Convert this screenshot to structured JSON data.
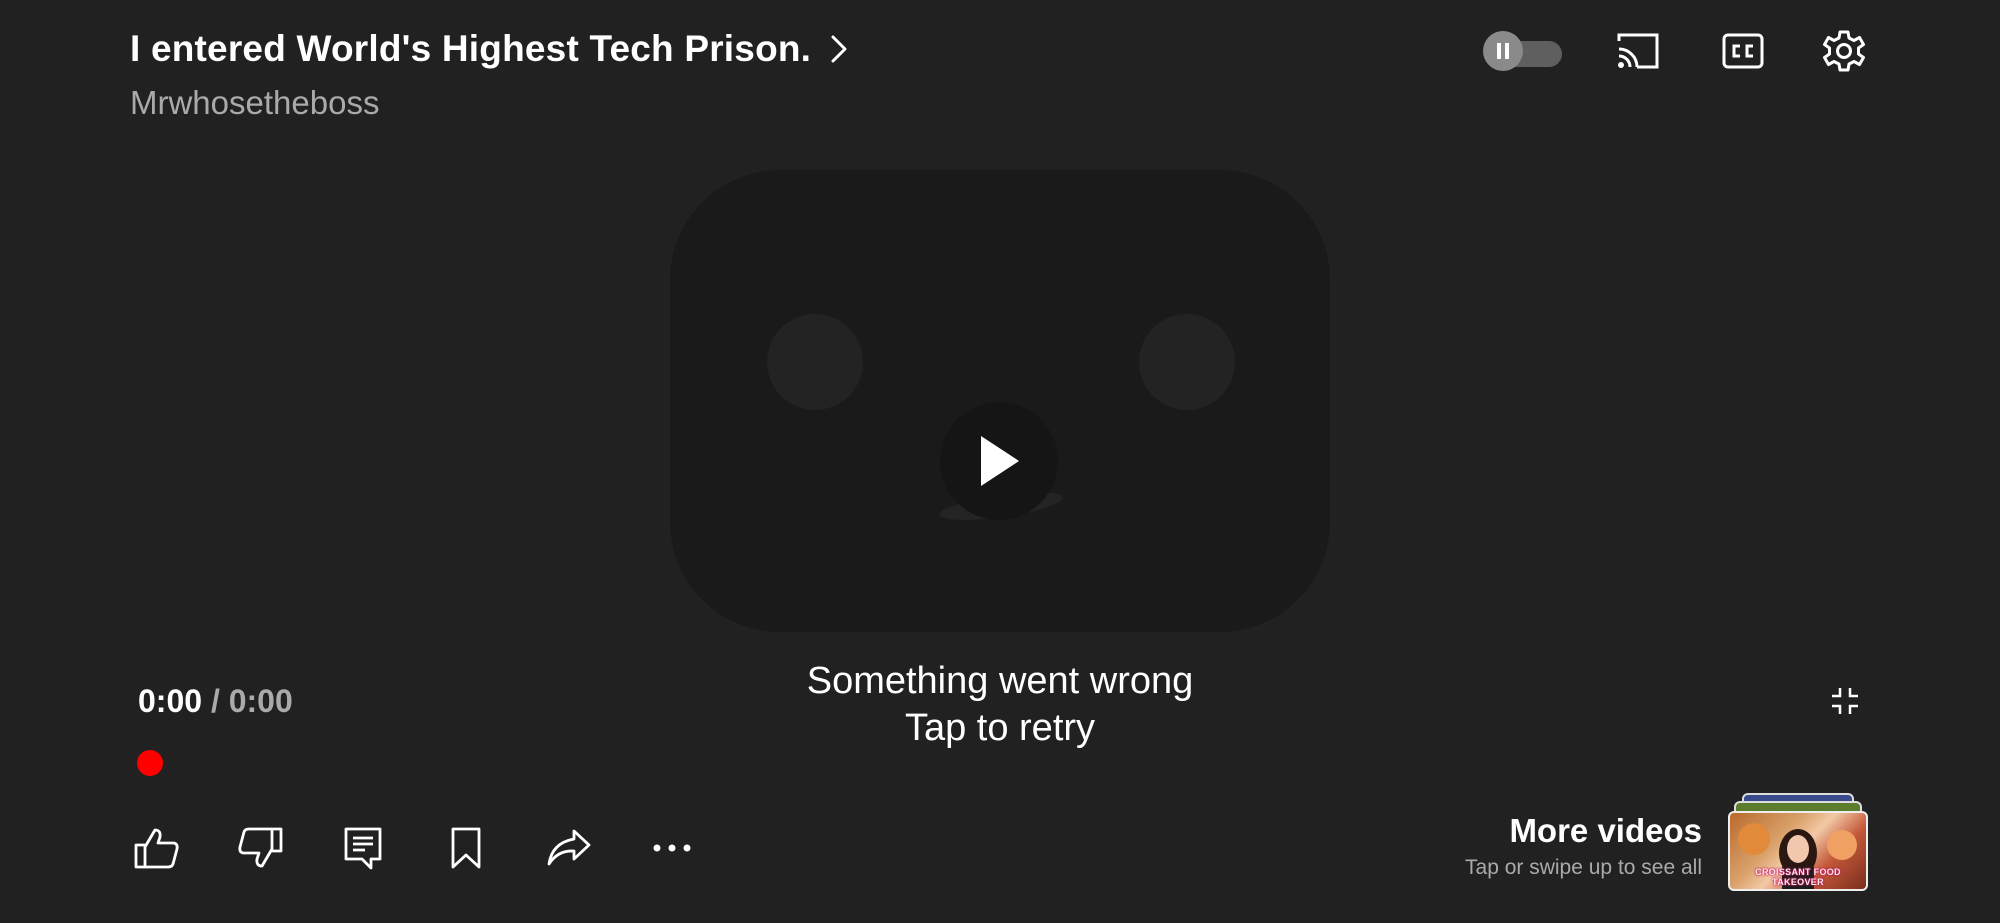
{
  "video": {
    "title": "I entered World's Highest Tech Prison.",
    "channel": "Mrwhosetheboss"
  },
  "controls": {
    "autoplay_state": "paused",
    "cast_icon": "cast-icon",
    "captions_icon": "closed-captions-icon",
    "settings_icon": "gear-icon"
  },
  "player": {
    "error_line1": "Something went wrong",
    "error_line2": "Tap to retry",
    "current_time": "0:00",
    "separator": " / ",
    "duration": "0:00",
    "progress_fraction": 0
  },
  "actions": [
    {
      "name": "like",
      "icon": "thumbs-up-icon"
    },
    {
      "name": "dislike",
      "icon": "thumbs-down-icon"
    },
    {
      "name": "comments",
      "icon": "comment-icon"
    },
    {
      "name": "save",
      "icon": "bookmark-icon"
    },
    {
      "name": "share",
      "icon": "share-arrow-icon"
    },
    {
      "name": "more",
      "icon": "more-dots-icon"
    }
  ],
  "more_videos": {
    "title": "More videos",
    "subtitle": "Tap or swipe up to see all",
    "thumbnail_caption": "CROISSANT FOOD TAKEOVER"
  },
  "colors": {
    "background": "#212121",
    "progress": "#ff0000",
    "secondary_text": "#aaaaaa"
  }
}
